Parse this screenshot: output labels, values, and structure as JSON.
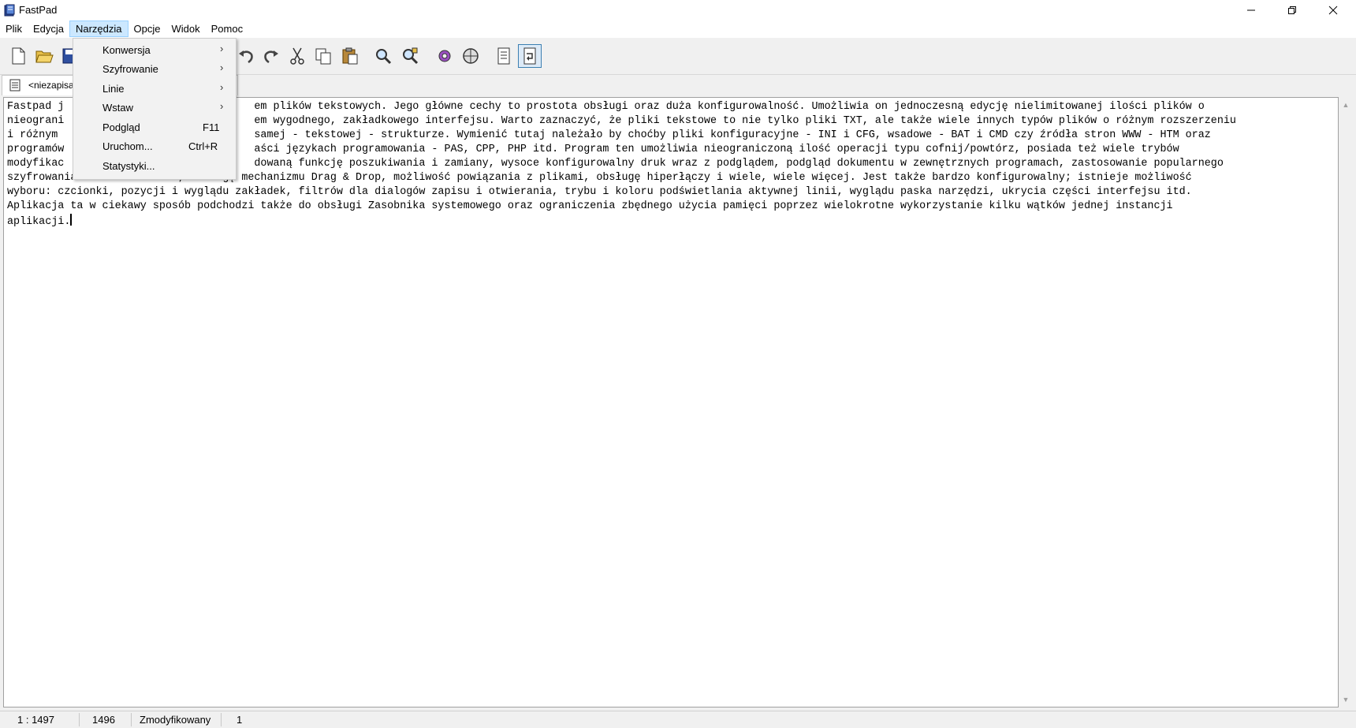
{
  "window": {
    "title": "FastPad",
    "icon": "fastpad-app-icon",
    "controls": [
      "minimize-icon",
      "restore-icon",
      "close-icon"
    ]
  },
  "menubar": {
    "items": [
      {
        "label": "Plik"
      },
      {
        "label": "Edycja"
      },
      {
        "label": "Narzędzia",
        "active": true
      },
      {
        "label": "Opcje"
      },
      {
        "label": "Widok"
      },
      {
        "label": "Pomoc"
      }
    ]
  },
  "toolbar": {
    "buttons": [
      "new-file-icon",
      "open-folder-icon",
      "save-icon",
      "undo-icon",
      "redo-icon",
      "cut-icon",
      "copy-icon",
      "paste-icon",
      "find-icon",
      "find-replace-icon",
      "settings-icon",
      "web-icon",
      "document-icon",
      "word-wrap-icon"
    ],
    "pressed": "word-wrap-icon"
  },
  "tabs": [
    {
      "label": "<niezapisa",
      "icon": "document-icon"
    }
  ],
  "dropdown": {
    "items": [
      {
        "label": "Konwersja",
        "submenu": true,
        "shortcut": ""
      },
      {
        "label": "Szyfrowanie",
        "submenu": true,
        "shortcut": ""
      },
      {
        "label": "Linie",
        "submenu": true,
        "shortcut": ""
      },
      {
        "label": "Wstaw",
        "submenu": true,
        "shortcut": ""
      },
      {
        "label": "Podgląd",
        "submenu": false,
        "shortcut": "F11"
      },
      {
        "label": "Uruchom...",
        "submenu": false,
        "shortcut": "Ctrl+R"
      },
      {
        "label": "Statystyki...",
        "submenu": false,
        "shortcut": ""
      }
    ]
  },
  "editor": {
    "lines": [
      "Fastpad j                              em plików tekstowych. Jego główne cechy to prostota obsługi oraz duża konfigurowalność. Umożliwia on jednoczesną edycję nielimitowanej ilości plików o",
      "nieograni                              em wygodnego, zakładkowego interfejsu. Warto zaznaczyć, że pliki tekstowe to nie tylko pliki TXT, ale także wiele innych typów plików o różnym rozszerzeniu",
      "i różnym                               samej - tekstowej - strukturze. Wymienić tutaj należało by choćby pliki konfiguracyjne - INI i CFG, wsadowe - BAT i CMD czy źródła stron WWW - HTM oraz",
      "programów                              aści językach programowania - PAS, CPP, PHP itd. Program ten umożliwia nieograniczoną ilość operacji typu cofnij/powtórz, posiada też wiele trybów",
      "modyfikac                              dowaną funkcję poszukiwania i zamiany, wysoce konfigurowalny druk wraz z podglądem, podgląd dokumentu w zewnętrznych programach, zastosowanie popularnego",
      "szyfrowania XOR lo i ROR 13, obsługę mechanizmu Drag & Drop, możliwość powiązania z plikami, obsługę hiperłączy i wiele, wiele więcej. Jest także bardzo konfigurowalny; istnieje możliwość",
      "wyboru: czcionki, pozycji i wyglądu zakładek, filtrów dla dialogów zapisu i otwierania, trybu i koloru podświetlania aktywnej linii, wyglądu paska narzędzi, ukrycia części interfejsu itd.",
      "Aplikacja ta w ciekawy sposób podchodzi także do obsługi Zasobnika systemowego oraz ograniczenia zbędnego użycia pamięci poprzez wielokrotne wykorzystanie kilku wątków jednej instancji",
      "aplikacji."
    ]
  },
  "statusbar": {
    "position": "1 : 1497",
    "count": "1496",
    "state": "Zmodyfikowany",
    "extra": "1"
  }
}
